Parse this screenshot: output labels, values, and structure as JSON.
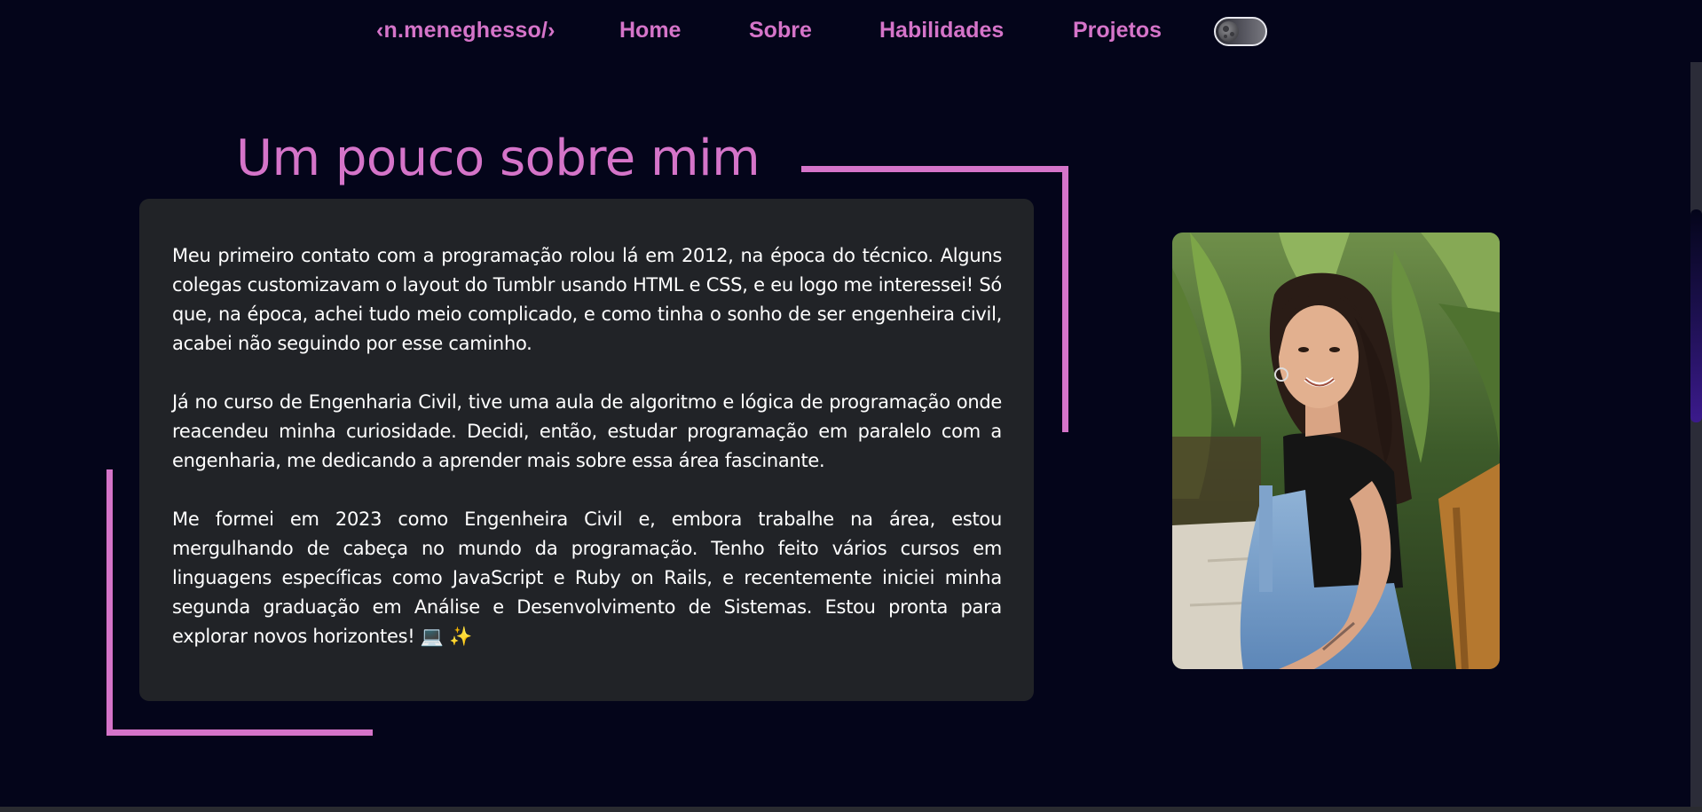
{
  "nav": {
    "logo": "‹n.meneghesso/›",
    "links": [
      "Home",
      "Sobre",
      "Habilidades",
      "Projetos"
    ],
    "theme_toggle_icon": "moon-icon"
  },
  "about": {
    "title": "Um pouco sobre mim",
    "paragraphs": [
      "Meu primeiro contato com a programação rolou lá em 2012, na época do técnico. Alguns colegas customizavam o layout do Tumblr usando HTML e CSS, e eu logo me interessei! Só que, na época, achei tudo meio complicado, e como tinha o sonho de ser engenheira civil, acabei não seguindo por esse caminho.",
      "Já no curso de Engenharia Civil, tive uma aula de algoritmo e lógica de programação onde reacendeu minha curiosidade. Decidi, então, estudar programação em paralelo com a engenharia, me dedicando a aprender mais sobre essa área fascinante.",
      "Me formei em 2023 como Engenheira Civil e, embora trabalhe na área, estou mergulhando de cabeça no mundo da programação. Tenho feito vários cursos em linguagens específicas como JavaScript e Ruby on Rails, e recentemente iniciei minha segunda graduação em Análise e Desenvolvimento de Sistemas. Estou pronta para explorar novos horizontes! 💻 ✨"
    ],
    "photo": "profile-photo"
  },
  "colors": {
    "background": "#04051a",
    "accent": "#d574c9",
    "card": "#212327",
    "text": "#ffffff"
  }
}
